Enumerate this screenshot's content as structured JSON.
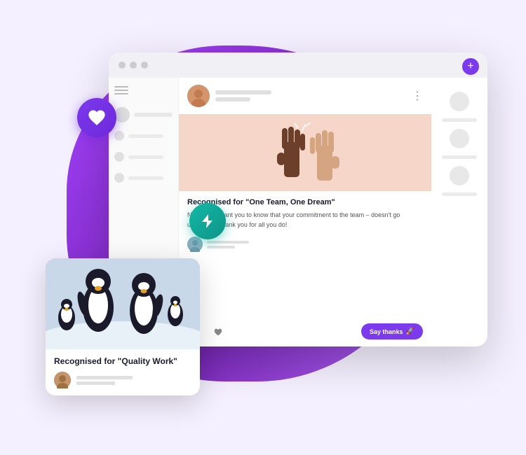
{
  "scene": {
    "browser": {
      "dots": [
        "dot1",
        "dot2",
        "dot3"
      ],
      "plus_label": "+",
      "card": {
        "title": "Recognised for \"One Team, One Dream\"",
        "body": "Nora, I just want you to know that your commitment to the team – doesn't go unnoticed. Thank you for all you do!",
        "more_icon": "⋮",
        "action_count_bolt": "",
        "action_count_heart": ""
      }
    },
    "say_thanks_button": {
      "label": "Say thanks",
      "icon": "🚀"
    },
    "small_card": {
      "title": "Recognised for \"Quality Work\""
    },
    "badges": {
      "heart": "♥",
      "lightning": "⚡"
    }
  }
}
